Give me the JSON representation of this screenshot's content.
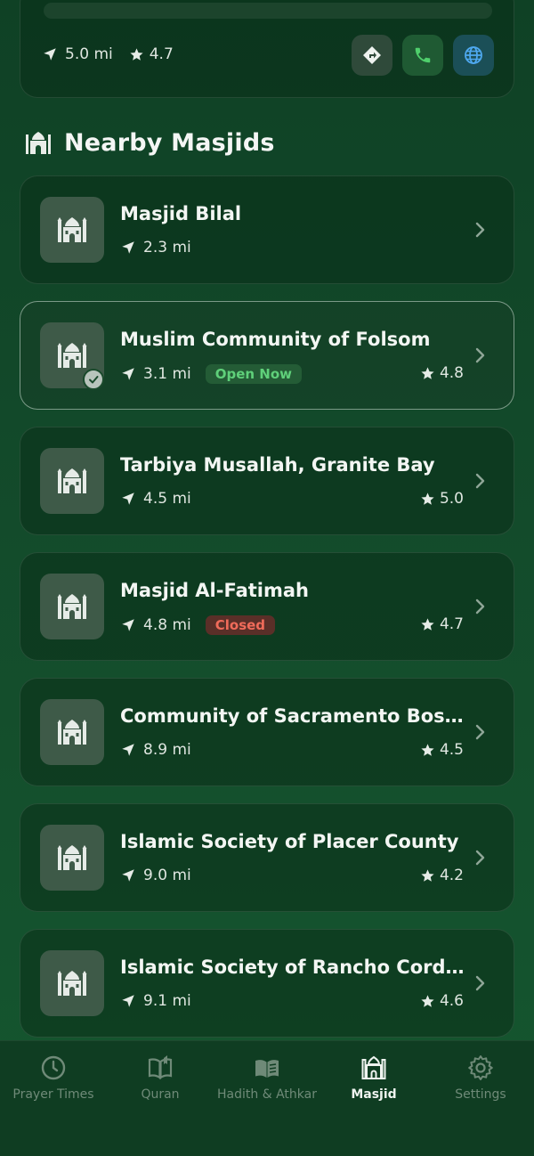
{
  "top_card": {
    "distance": "5.0 mi",
    "rating": "4.7",
    "actions": [
      "directions-icon",
      "phone-icon",
      "globe-icon"
    ]
  },
  "section": {
    "title": "Nearby Masjids",
    "icon": "masjid-icon"
  },
  "masjids": [
    {
      "name": "Masjid Bilal",
      "distance": "2.3 mi",
      "status": "",
      "rating": ""
    },
    {
      "name": "Muslim Community of Folsom",
      "distance": "3.1 mi",
      "status": "Open Now",
      "rating": "4.8",
      "selected": true
    },
    {
      "name": "Tarbiya Musallah, Granite Bay",
      "distance": "4.5 mi",
      "status": "",
      "rating": "5.0"
    },
    {
      "name": "Masjid Al-Fatimah",
      "distance": "4.8 mi",
      "status": "Closed",
      "rating": "4.7"
    },
    {
      "name": "Community of Sacramento Bosn...",
      "distance": "8.9 mi",
      "status": "",
      "rating": "4.5"
    },
    {
      "name": "Islamic Society of Placer County",
      "distance": "9.0 mi",
      "status": "",
      "rating": "4.2"
    },
    {
      "name": "Islamic Society of Rancho Cordo...",
      "distance": "9.1 mi",
      "status": "",
      "rating": "4.6"
    }
  ],
  "bottom_nav": {
    "active": "Masjid",
    "items": [
      {
        "label": "Prayer Times",
        "icon": "clock-icon"
      },
      {
        "label": "Quran",
        "icon": "book-icon"
      },
      {
        "label": "Hadith & Athkar",
        "icon": "open-book-icon"
      },
      {
        "label": "Masjid",
        "icon": "masjid-icon"
      },
      {
        "label": "Settings",
        "icon": "gear-icon"
      }
    ]
  },
  "colors": {
    "background": "#134b2b",
    "open_badge": "#5fd07a",
    "closed_badge": "#f06b5a",
    "call_button": "#1f5a33",
    "web_button": "#1b4f57"
  }
}
